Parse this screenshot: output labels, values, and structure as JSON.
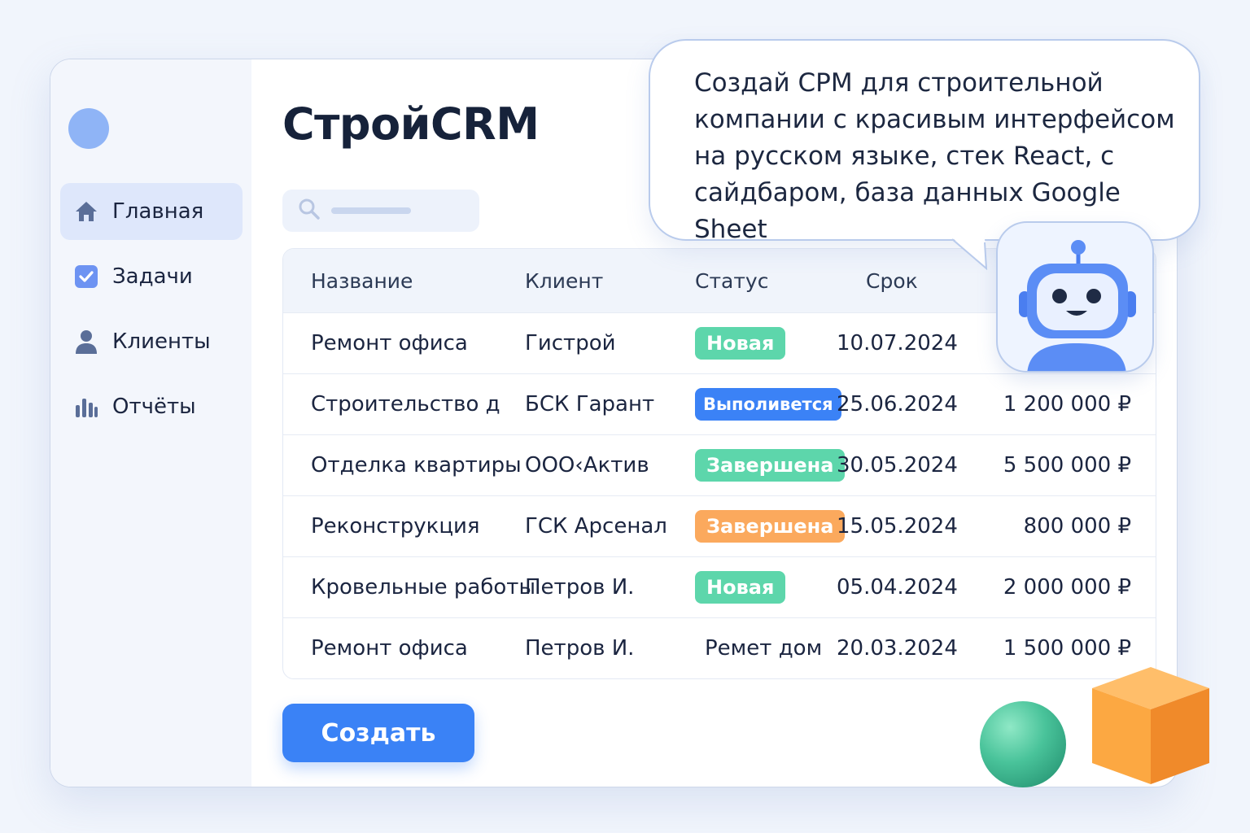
{
  "app": {
    "title": "СтройCRM"
  },
  "sidebar": {
    "items": [
      {
        "label": "Главная",
        "icon": "home-icon",
        "active": true
      },
      {
        "label": "Задачи",
        "icon": "checkbox-icon",
        "active": false
      },
      {
        "label": "Клиенты",
        "icon": "user-icon",
        "active": false
      },
      {
        "label": "Отчёты",
        "icon": "bar-chart-icon",
        "active": false
      }
    ]
  },
  "search": {
    "icon": "search-icon"
  },
  "table": {
    "headers": [
      "Название",
      "Клиент",
      "Статус",
      "Срок"
    ],
    "rows": [
      {
        "name": "Ремонт офиса",
        "client": "Гистрой",
        "status": "Новая",
        "status_color": "#5dd6ab",
        "date": "10.07.2024",
        "amount": ""
      },
      {
        "name": "Строительство д",
        "client": "БСК Гарант",
        "status": "Выполивется",
        "status_color": "#3b82f6",
        "date": "25.06.2024",
        "amount": "1 200 000 ₽"
      },
      {
        "name": "Отделка квартиры",
        "client": "ООО‹Актив",
        "status": "Завершена",
        "status_color": "#5dd6ab",
        "date": "30.05.2024",
        "amount": "5 500 000 ₽"
      },
      {
        "name": "Реконструкция",
        "client": "ГСК Арсенал",
        "status": "Завершена",
        "status_color": "#fba95d",
        "date": "15.05.2024",
        "amount": "800 000 ₽"
      },
      {
        "name": "Кровельные работы",
        "client": "Петров И.",
        "status": "Новая",
        "status_color": "#5dd6ab",
        "date": "05.04.2024",
        "amount": "2 000 000 ₽"
      },
      {
        "name": "Ремонт офиса",
        "client": "Петров И.",
        "status": "Ремет дом",
        "status_color": "",
        "date": "20.03.2024",
        "amount": "1 500 000 ₽"
      }
    ]
  },
  "actions": {
    "create_label": "Создать"
  },
  "chat": {
    "lines": [
      "Создай СРМ для строительной",
      "компании с красивым интерфейсом",
      "на русском языке, стек React, с",
      "сайдбаром, база данных Google Sheet"
    ],
    "avatar_icon": "robot-icon"
  },
  "colors": {
    "accent": "#3a82f6",
    "green": "#5dd6ab",
    "orange": "#fba95d"
  }
}
